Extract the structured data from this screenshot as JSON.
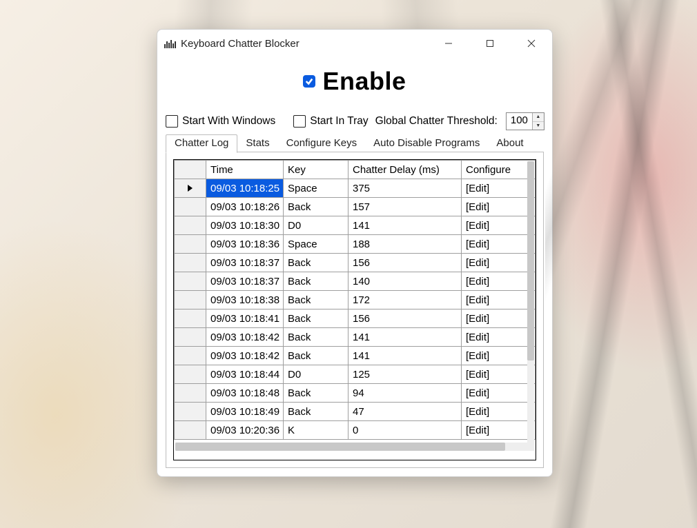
{
  "window": {
    "title": "Keyboard Chatter Blocker"
  },
  "enable": {
    "label": "Enable",
    "checked": true
  },
  "options": {
    "start_with_windows_label": "Start With Windows",
    "start_with_windows_checked": false,
    "start_in_tray_label": "Start In Tray",
    "start_in_tray_checked": false,
    "threshold_label": "Global Chatter Threshold:",
    "threshold_value": "100"
  },
  "tabs": {
    "items": [
      "Chatter Log",
      "Stats",
      "Configure Keys",
      "Auto Disable Programs",
      "About"
    ],
    "active_index": 0
  },
  "table": {
    "columns": [
      "Time",
      "Key",
      "Chatter Delay (ms)",
      "Configure"
    ],
    "edit_label": "[Edit]",
    "selected_row_index": 0,
    "rows": [
      {
        "time": "09/03 10:18:25",
        "key": "Space",
        "delay": "375"
      },
      {
        "time": "09/03 10:18:26",
        "key": "Back",
        "delay": "157"
      },
      {
        "time": "09/03 10:18:30",
        "key": "D0",
        "delay": "141"
      },
      {
        "time": "09/03 10:18:36",
        "key": "Space",
        "delay": "188"
      },
      {
        "time": "09/03 10:18:37",
        "key": "Back",
        "delay": "156"
      },
      {
        "time": "09/03 10:18:37",
        "key": "Back",
        "delay": "140"
      },
      {
        "time": "09/03 10:18:38",
        "key": "Back",
        "delay": "172"
      },
      {
        "time": "09/03 10:18:41",
        "key": "Back",
        "delay": "156"
      },
      {
        "time": "09/03 10:18:42",
        "key": "Back",
        "delay": "141"
      },
      {
        "time": "09/03 10:18:42",
        "key": "Back",
        "delay": "141"
      },
      {
        "time": "09/03 10:18:44",
        "key": "D0",
        "delay": "125"
      },
      {
        "time": "09/03 10:18:48",
        "key": "Back",
        "delay": "94"
      },
      {
        "time": "09/03 10:18:49",
        "key": "Back",
        "delay": "47"
      },
      {
        "time": "09/03 10:20:36",
        "key": "K",
        "delay": "0"
      }
    ]
  }
}
